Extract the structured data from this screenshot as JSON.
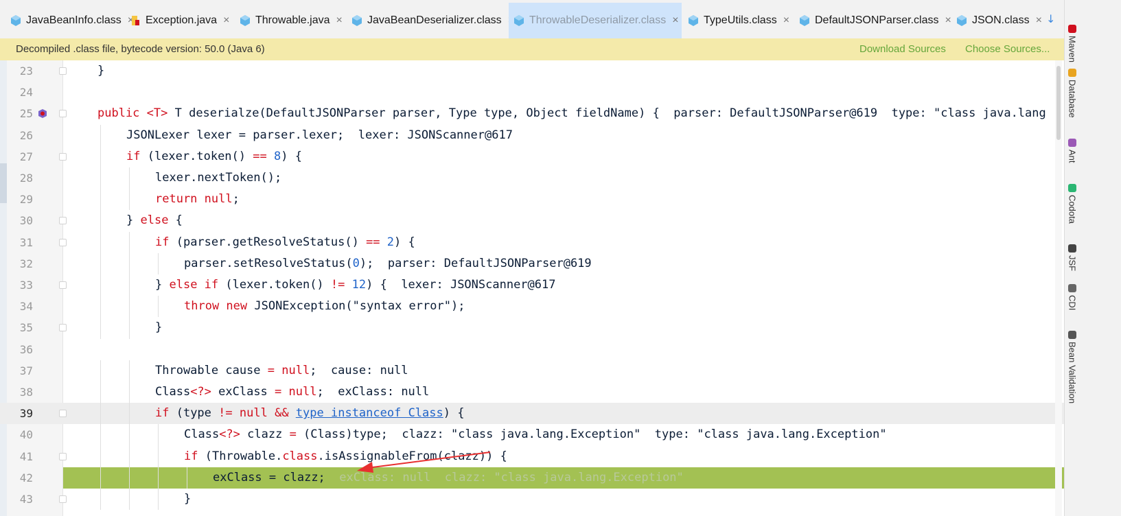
{
  "tabs": [
    {
      "label": "JavaBeanInfo.class",
      "icon": "class-file-icon",
      "active": false
    },
    {
      "label": "Exception.java",
      "icon": "java-file-icon",
      "active": false
    },
    {
      "label": "Throwable.java",
      "icon": "class-file-icon",
      "active": false
    },
    {
      "label": "JavaBeanDeserializer.class",
      "icon": "class-file-icon",
      "active": false
    },
    {
      "label": "ThrowableDeserializer.class",
      "icon": "class-file-icon",
      "active": true
    },
    {
      "label": "TypeUtils.class",
      "icon": "class-file-icon",
      "active": false
    },
    {
      "label": "DefaultJSONParser.class",
      "icon": "class-file-icon",
      "active": false
    },
    {
      "label": "JSON.class",
      "icon": "class-file-icon",
      "active": false
    }
  ],
  "tab_close": "×",
  "tab_more": "↓",
  "banner": {
    "text": "Decompiled .class file, bytecode version: 50.0 (Java 6)",
    "download_sources": "Download Sources",
    "choose_sources": "Choose Sources..."
  },
  "right_tools": [
    {
      "label": "Maven",
      "icon": "maven-icon"
    },
    {
      "label": "Database",
      "icon": "database-icon"
    },
    {
      "label": "Ant",
      "icon": "ant-icon"
    },
    {
      "label": "Codota",
      "icon": "codota-icon"
    },
    {
      "label": "JSF",
      "icon": "jsf-icon"
    },
    {
      "label": "CDI",
      "icon": "cdi-icon"
    },
    {
      "label": "Bean Validation",
      "icon": "bean-validation-icon"
    }
  ],
  "current_line": "39",
  "execution_line": "42",
  "lines": [
    {
      "n": "23",
      "tokens": [
        {
          "t": "}",
          "c": ""
        }
      ]
    },
    {
      "n": "24",
      "tokens": []
    },
    {
      "n": "25",
      "tokens": [
        {
          "t": "public ",
          "c": "kw"
        },
        {
          "t": "<T>",
          "c": "kw"
        },
        {
          "t": " T deserialze(DefaultJSONParser parser, Type type, Object fieldName) {  ",
          "c": ""
        },
        {
          "t": "parser: DefaultJSONParser@619  type: \"class java.lang",
          "c": "hint"
        }
      ]
    },
    {
      "n": "26",
      "tokens": [
        {
          "t": "JSONLexer lexer = parser.lexer;  ",
          "c": ""
        },
        {
          "t": "lexer: JSONScanner@617",
          "c": "hint"
        }
      ]
    },
    {
      "n": "27",
      "tokens": [
        {
          "t": "if",
          "c": "kw"
        },
        {
          "t": " (lexer.token() ",
          "c": ""
        },
        {
          "t": "==",
          "c": "kw"
        },
        {
          "t": " ",
          "c": ""
        },
        {
          "t": "8",
          "c": "num"
        },
        {
          "t": ") {",
          "c": ""
        }
      ]
    },
    {
      "n": "28",
      "tokens": [
        {
          "t": "lexer.nextToken();",
          "c": ""
        }
      ]
    },
    {
      "n": "29",
      "tokens": [
        {
          "t": "return null",
          "c": "kw"
        },
        {
          "t": ";",
          "c": ""
        }
      ]
    },
    {
      "n": "30",
      "tokens": [
        {
          "t": "} ",
          "c": ""
        },
        {
          "t": "else",
          "c": "kw"
        },
        {
          "t": " {",
          "c": ""
        }
      ]
    },
    {
      "n": "31",
      "tokens": [
        {
          "t": "if",
          "c": "kw"
        },
        {
          "t": " (parser.getResolveStatus() ",
          "c": ""
        },
        {
          "t": "==",
          "c": "kw"
        },
        {
          "t": " ",
          "c": ""
        },
        {
          "t": "2",
          "c": "num"
        },
        {
          "t": ") {",
          "c": ""
        }
      ]
    },
    {
      "n": "32",
      "tokens": [
        {
          "t": "parser.setResolveStatus(",
          "c": ""
        },
        {
          "t": "0",
          "c": "num"
        },
        {
          "t": ");  ",
          "c": ""
        },
        {
          "t": "parser: DefaultJSONParser@619",
          "c": "hint"
        }
      ]
    },
    {
      "n": "33",
      "tokens": [
        {
          "t": "} ",
          "c": ""
        },
        {
          "t": "else if",
          "c": "kw"
        },
        {
          "t": " (lexer.token() ",
          "c": ""
        },
        {
          "t": "!=",
          "c": "kw"
        },
        {
          "t": " ",
          "c": ""
        },
        {
          "t": "12",
          "c": "num"
        },
        {
          "t": ") {  ",
          "c": ""
        },
        {
          "t": "lexer: JSONScanner@617",
          "c": "hint"
        }
      ]
    },
    {
      "n": "34",
      "tokens": [
        {
          "t": "throw new",
          "c": "kw"
        },
        {
          "t": " JSONException(",
          "c": ""
        },
        {
          "t": "\"syntax error\"",
          "c": "str"
        },
        {
          "t": ");",
          "c": ""
        }
      ]
    },
    {
      "n": "35",
      "tokens": [
        {
          "t": "}",
          "c": ""
        }
      ]
    },
    {
      "n": "36",
      "tokens": []
    },
    {
      "n": "37",
      "tokens": [
        {
          "t": "Throwable cause ",
          "c": ""
        },
        {
          "t": "=",
          "c": "kw"
        },
        {
          "t": " ",
          "c": ""
        },
        {
          "t": "null",
          "c": "kw"
        },
        {
          "t": ";  ",
          "c": ""
        },
        {
          "t": "cause: null",
          "c": "hint"
        }
      ]
    },
    {
      "n": "38",
      "tokens": [
        {
          "t": "Class",
          "c": ""
        },
        {
          "t": "<?>",
          "c": "kw"
        },
        {
          "t": " exClass ",
          "c": ""
        },
        {
          "t": "=",
          "c": "kw"
        },
        {
          "t": " ",
          "c": ""
        },
        {
          "t": "null",
          "c": "kw"
        },
        {
          "t": ";  ",
          "c": ""
        },
        {
          "t": "exClass: null",
          "c": "hint"
        }
      ]
    },
    {
      "n": "39",
      "tokens": [
        {
          "t": "if",
          "c": "kw"
        },
        {
          "t": " (type ",
          "c": ""
        },
        {
          "t": "!=",
          "c": "kw"
        },
        {
          "t": " ",
          "c": ""
        },
        {
          "t": "null",
          "c": "kw"
        },
        {
          "t": " ",
          "c": ""
        },
        {
          "t": "&&",
          "c": "kw"
        },
        {
          "t": " ",
          "c": ""
        },
        {
          "t": "type instanceof Class",
          "c": "link"
        },
        {
          "t": ") {",
          "c": ""
        }
      ]
    },
    {
      "n": "40",
      "tokens": [
        {
          "t": "Class",
          "c": ""
        },
        {
          "t": "<?>",
          "c": "kw"
        },
        {
          "t": " clazz ",
          "c": ""
        },
        {
          "t": "=",
          "c": "kw"
        },
        {
          "t": " (Class)type;  ",
          "c": ""
        },
        {
          "t": "clazz: \"class java.lang.Exception\"  type: \"class java.lang.Exception\"",
          "c": "hint"
        }
      ]
    },
    {
      "n": "41",
      "tokens": [
        {
          "t": "if",
          "c": "kw"
        },
        {
          "t": " (Throwable.",
          "c": ""
        },
        {
          "t": "class",
          "c": "kw"
        },
        {
          "t": ".isAssignableFrom(clazz)) {",
          "c": ""
        }
      ]
    },
    {
      "n": "42",
      "tokens": [
        {
          "t": "exClass ",
          "c": ""
        },
        {
          "t": "=",
          "c": ""
        },
        {
          "t": " clazz;  ",
          "c": ""
        },
        {
          "t": "exClass: null  clazz: \"class java.lang.Exception\"",
          "c": "dim"
        }
      ]
    },
    {
      "n": "43",
      "tokens": [
        {
          "t": "}",
          "c": ""
        }
      ]
    }
  ],
  "indents": {
    "23": 1,
    "24": 0,
    "25": 1,
    "26": 2,
    "27": 2,
    "28": 3,
    "29": 3,
    "30": 2,
    "31": 3,
    "32": 4,
    "33": 3,
    "34": 4,
    "35": 3,
    "36": 0,
    "37": 3,
    "38": 3,
    "39": 3,
    "40": 4,
    "41": 4,
    "42": 5,
    "43": 4
  },
  "accent_colors": {
    "active_tab": "#cfe4fb",
    "banner_bg": "#f4eaaa",
    "banner_link": "#65a63b",
    "execution_line_bg": "#a3c153",
    "current_line_bg": "#ededed",
    "keyword": "#d0101e",
    "number": "#1f63c9",
    "arrow": "#e83030"
  }
}
